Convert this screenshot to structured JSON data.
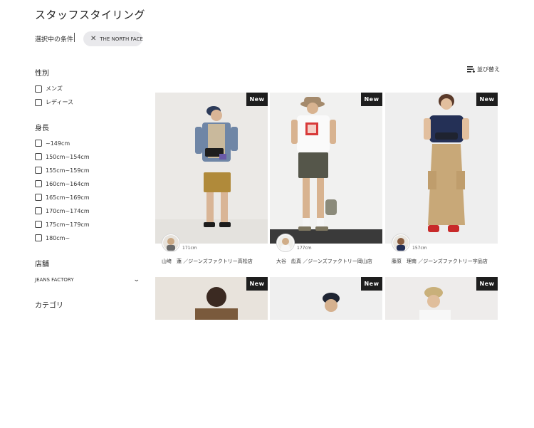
{
  "page": {
    "title": "スタッフスタイリング"
  },
  "conditions": {
    "label": "選択中の条件",
    "chip_label": "THE NORTH FACE"
  },
  "sort": {
    "label": "並び替え"
  },
  "filters": {
    "gender": {
      "title": "性別",
      "options": [
        "メンズ",
        "レディース"
      ]
    },
    "height": {
      "title": "身長",
      "options": [
        "~149cm",
        "150cm~154cm",
        "155cm~159cm",
        "160cm~164cm",
        "165cm~169cm",
        "170cm~174cm",
        "175cm~179cm",
        "180cm~"
      ]
    },
    "store": {
      "title": "店舗",
      "selected": "JEANS FACTORY"
    },
    "category": {
      "title": "カテゴリ"
    }
  },
  "cards": [
    {
      "badge": "New",
      "height": "171cm",
      "staff": "山﨑　蓮 ／ジーンズファクトリー高松店"
    },
    {
      "badge": "New",
      "height": "177cm",
      "staff": "大谷　彪真 ／ジーンズファクトリー岡山店"
    },
    {
      "badge": "New",
      "height": "157cm",
      "staff": "藤原　理南 ／ジーンズファクトリー宇品店"
    },
    {
      "badge": "New"
    },
    {
      "badge": "New"
    },
    {
      "badge": "New"
    }
  ],
  "colors": {
    "badge_bg": "#1e1e1e",
    "chip_bg": "#e9e9ec"
  },
  "icons": {
    "chip_remove": "close-icon",
    "sort": "sort-icon",
    "store_toggle": "chevron-down-icon"
  }
}
